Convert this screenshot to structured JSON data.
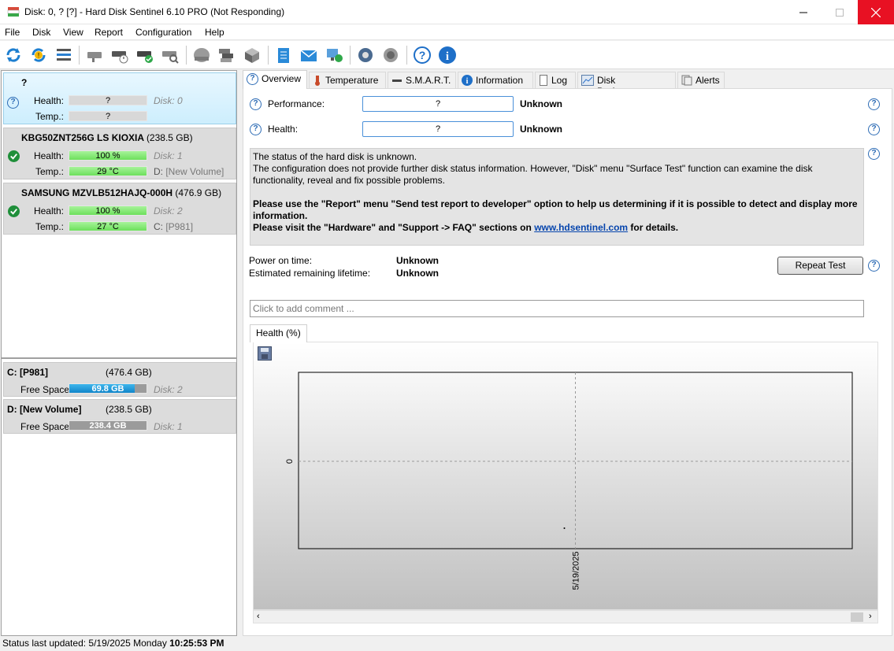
{
  "window": {
    "title": "Disk: 0, ? [?]  -  Hard Disk Sentinel 6.10 PRO (Not Responding)"
  },
  "menu": [
    "File",
    "Disk",
    "View",
    "Report",
    "Configuration",
    "Help"
  ],
  "toolbar": {
    "icons": [
      "refresh-icon",
      "refresh-warning-icon",
      "disk-list-icon",
      "disk-gray-icon",
      "disk-clock-icon",
      "disk-check-icon",
      "disk-search-icon",
      "disk-round-icon",
      "disks-icon",
      "disk-cube-icon",
      "report-notepad-icon",
      "mail-icon",
      "network-globe-icon",
      "gear-icon",
      "speaker-icon",
      "help-icon",
      "info-icon"
    ]
  },
  "disks": [
    {
      "name": "?",
      "size": "",
      "health_label": "Health:",
      "health": "?",
      "temp_label": "Temp.:",
      "temp": "?",
      "disk_label": "Disk: 0",
      "vol_label": "",
      "vol_name": "",
      "status": "unknown"
    },
    {
      "name": "KBG50ZNT256G LS KIOXIA",
      "size": "(238.5 GB)",
      "health_label": "Health:",
      "health": "100 %",
      "temp_label": "Temp.:",
      "temp": "29 °C",
      "disk_label": "Disk: 1",
      "vol_label": "D:",
      "vol_name": "[New Volume]",
      "status": "ok"
    },
    {
      "name": "SAMSUNG MZVLB512HAJQ-000H",
      "size": "(476.9 GB)",
      "health_label": "Health:",
      "health": "100 %",
      "temp_label": "Temp.:",
      "temp": "27 °C",
      "disk_label": "Disk: 2",
      "vol_label": "C:",
      "vol_name": "[P981]",
      "status": "ok"
    }
  ],
  "volumes": [
    {
      "name": "C: [P981]",
      "size": "(476.4 GB)",
      "free_label": "Free Space",
      "free": "69.8 GB",
      "free_fraction": 0.85,
      "disk_label": "Disk: 2"
    },
    {
      "name": "D: [New Volume]",
      "size": "(238.5 GB)",
      "free_label": "Free Space",
      "free": "238.4 GB",
      "free_fraction": 1.0,
      "disk_label": "Disk: 1"
    }
  ],
  "tabs": [
    "Overview",
    "Temperature",
    "S.M.A.R.T.",
    "Information",
    "Log",
    "Disk Performance",
    "Alerts"
  ],
  "overview": {
    "performance_label": "Performance:",
    "performance_value": "?",
    "performance_status": "Unknown",
    "health_label": "Health:",
    "health_value": "?",
    "health_status": "Unknown",
    "msg_line1": "The status of the hard disk is unknown.",
    "msg_line2": "The configuration does not provide further disk status information. However, \"Disk\" menu \"Surface Test\" function can examine the disk functionality, reveal and fix possible problems.",
    "msg_bold1": "Please use the \"Report\" menu \"Send test report to developer\" option to help us determining if it is possible to detect and display more information.",
    "msg_bold2_pre": "Please visit the \"Hardware\" and \"Support -> FAQ\" sections on ",
    "msg_link": "www.hdsentinel.com",
    "msg_bold2_post": " for details.",
    "power_on_label": "Power on time:",
    "power_on_value": "Unknown",
    "lifetime_label": "Estimated remaining lifetime:",
    "lifetime_value": "Unknown",
    "repeat_button": "Repeat Test",
    "comment_placeholder": "Click to add comment ..."
  },
  "chart_tab": "Health (%)",
  "chart_data": {
    "type": "line",
    "x": [
      "5/19/2025"
    ],
    "series": [
      {
        "values": [
          0
        ]
      }
    ],
    "ytick_labels": [
      "0"
    ],
    "xtick_labels": [
      "5/19/2025"
    ],
    "grid": true
  },
  "status": {
    "prefix": "Status last updated: 5/19/2025 Monday ",
    "time": "10:25:53 PM"
  }
}
